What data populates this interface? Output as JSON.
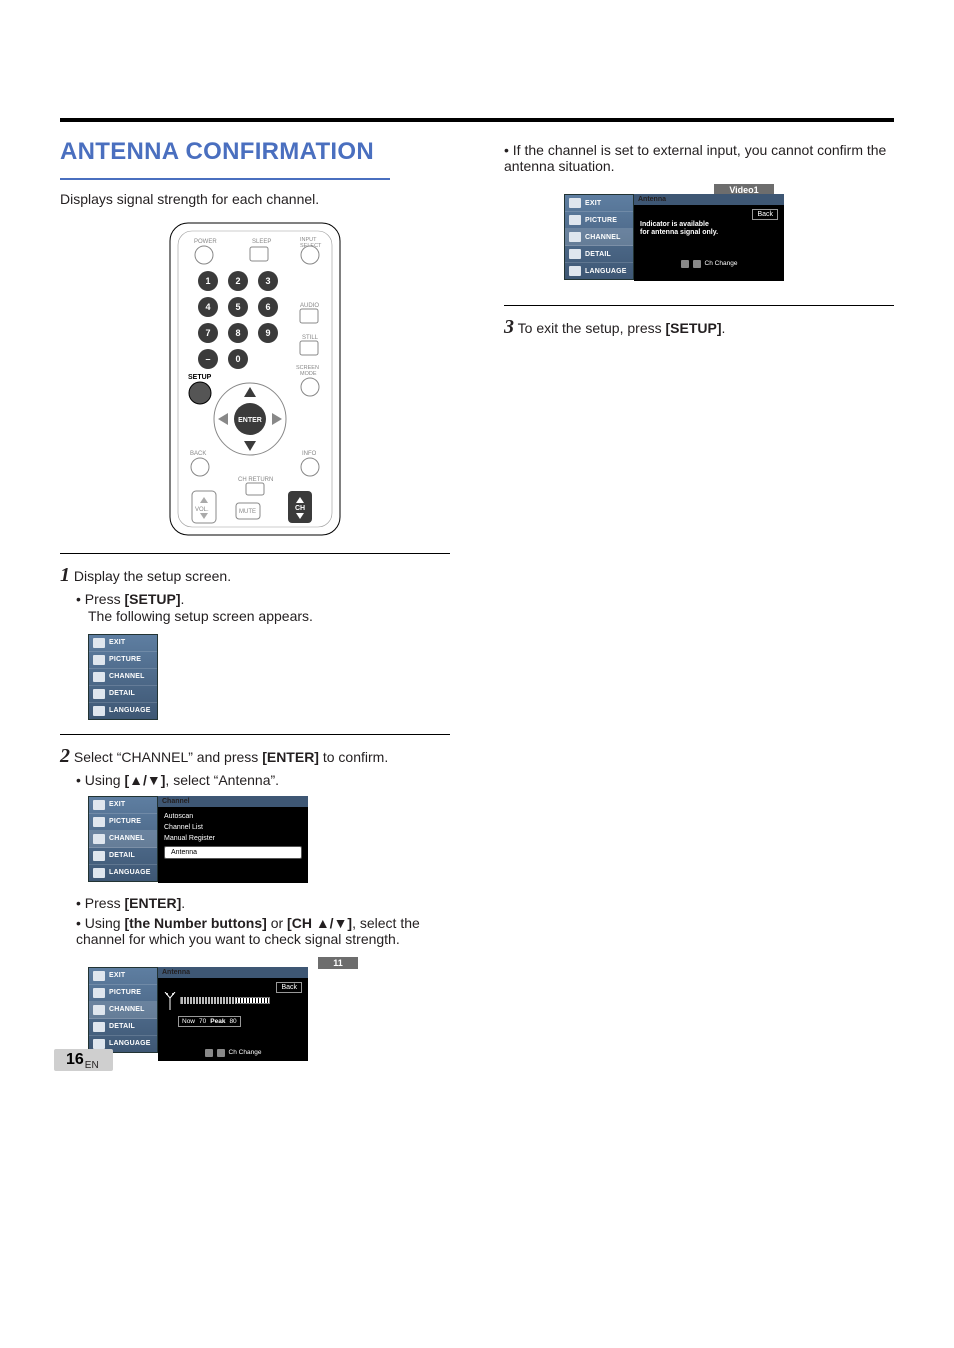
{
  "section": {
    "title": "ANTENNA CONFIRMATION",
    "subtitle": "Displays signal strength for each channel."
  },
  "remote": {
    "labels": {
      "power": "POWER",
      "sleep": "SLEEP",
      "input_select": "INPUT SELECT",
      "audio": "AUDIO",
      "still": "STILL",
      "screen_mode": "SCREEN MODE",
      "setup": "SETUP",
      "enter": "ENTER",
      "back": "BACK",
      "info": "INFO",
      "ch_return": "CH RETURN",
      "vol": "VOL.",
      "mute": "MUTE",
      "ch": "CH"
    },
    "numbers": [
      "1",
      "2",
      "3",
      "4",
      "5",
      "6",
      "7",
      "8",
      "9",
      "–",
      "0"
    ]
  },
  "steps": {
    "s1": {
      "num": "1",
      "text": "Display the setup screen.",
      "bullet1_prefix": "Press ",
      "bullet1_bold": "[SETUP]",
      "bullet1_suffix": ".",
      "line2": "The following setup screen appears."
    },
    "s2": {
      "num": "2",
      "text_prefix": "Select “CHANNEL” and press ",
      "text_bold": "[ENTER]",
      "text_suffix": " to confirm.",
      "bullet1_prefix": "Using ",
      "bullet1_bold": "[▲/▼]",
      "bullet1_suffix": ", select “Antenna”.",
      "bullet2_prefix": "Press ",
      "bullet2_bold": "[ENTER]",
      "bullet2_suffix": ".",
      "bullet3_prefix": "Using ",
      "bullet3_bold1": "[the Number buttons]",
      "bullet3_mid": " or ",
      "bullet3_bold2": "[CH ▲/▼]",
      "bullet3_suffix": ", select the channel for which you want to check signal strength."
    },
    "s3": {
      "num": "3",
      "text_prefix": "To exit the setup, press ",
      "text_bold": "[SETUP]",
      "text_suffix": "."
    }
  },
  "right_note": "If the channel is set to external input, you cannot confirm the antenna situation.",
  "sidebar": {
    "items": [
      "EXIT",
      "PICTURE",
      "CHANNEL",
      "DETAIL",
      "LANGUAGE"
    ]
  },
  "channel_panel": {
    "header": "Channel",
    "items": [
      "Autoscan",
      "Channel List",
      "Manual Register",
      "Antenna"
    ],
    "selected_index": 3
  },
  "antenna_panel": {
    "header": "Antenna",
    "back": "Back",
    "stats": {
      "now_label": "Now",
      "now": "70",
      "peak_label": "Peak",
      "peak": "80"
    },
    "footer": "Ch Change",
    "ch_badge": "11"
  },
  "video_panel": {
    "header": "Antenna",
    "back": "Back",
    "badge": "Video1",
    "note_line1": "Indicator is available",
    "note_line2": "for antenna signal only.",
    "footer": "Ch Change"
  },
  "footer": {
    "page": "16",
    "lang": "EN"
  }
}
